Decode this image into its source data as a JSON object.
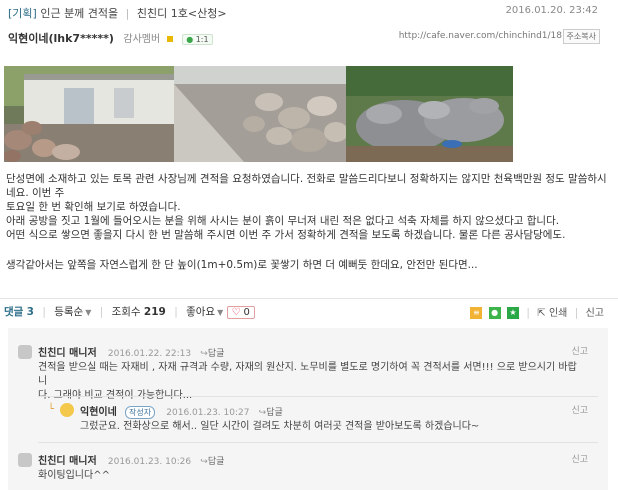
{
  "post": {
    "category": "[기획]",
    "title": "인근 분께 견적을",
    "board": "친친디 1호<산청>",
    "date": "2016.01.20. 23:42"
  },
  "author": {
    "name": "익현이네(lhk7*****)",
    "rank": "감사멤버",
    "chat_label": "1:1",
    "url": "http://cafe.naver.com/chinchind1/18",
    "copy_label": "주소복사"
  },
  "body": {
    "paragraphs": [
      "단성면에 소재하고 있는 토목 관련 사장님께 견적을 요청하였습니다. 전화로 말씀드리다보니 정확하지는 않지만 천육백만원 정도 말씀하시네요. 이번 주",
      "토요일 한 번 확인해 보기로 하였습니다.",
      "아래 공방을 짓고 1월에 들어오시는 분을 위해 사시는 분이 흙이 무너져 내린 적은 없다고 석축 자체를 하지 않으셨다고 합니다.",
      "어떤 식으로 쌓으면 좋을지 다시 한 번 말씀해 주시면 이번 주 가서 정확하게 견적을 보도록 하겠습니다.  물론 다른 공사담당에도.",
      "생각같아서는 앞쪽을 자연스럽게 한 단 높이(1m+0.5m)로 꽃쌓기 하면 더 예뻐둣 한데요, 안전만 된다면..."
    ]
  },
  "toolbar": {
    "comment_label": "댓글",
    "comment_count": "3",
    "sort_label": "등록순",
    "views_label": "조회수",
    "views_count": "219",
    "like_label": "좋아요",
    "like_count": "0",
    "print_label": "인쇄",
    "report_label": "신고"
  },
  "comments": [
    {
      "name": "친친디 매니저",
      "date": "2016.01.22. 22:13",
      "reply_label": "답글",
      "report_label": "신고",
      "lines": [
        "견적을 받으실 때는 자재비 , 자재 규격과 수량, 자재의 원산지. 노무비를 별도로 명기하여 꼭 견적서를 서면!!! 으로 받으시기 바랍니",
        "다. 그래야 비교 견적이 가능합니다..."
      ]
    },
    {
      "name": "익현이네",
      "writer_badge": "작성자",
      "date": "2016.01.23. 10:27",
      "reply_label": "답글",
      "report_label": "신고",
      "lines": [
        "그렀군요. 전화상으로 해서.. 일단 시간이 걸려도 차분히 여러곳 견적을 받아보도록 하겠습니다~"
      ]
    },
    {
      "name": "친친디 매니저",
      "date": "2016.01.23. 10:26",
      "reply_label": "답글",
      "report_label": "신고",
      "lines": [
        "화이팅입니다^^"
      ]
    }
  ],
  "colors": {
    "accent": "#2d6e8a",
    "comment_bg": "#f5f5f5",
    "like_heart": "#e24"
  }
}
